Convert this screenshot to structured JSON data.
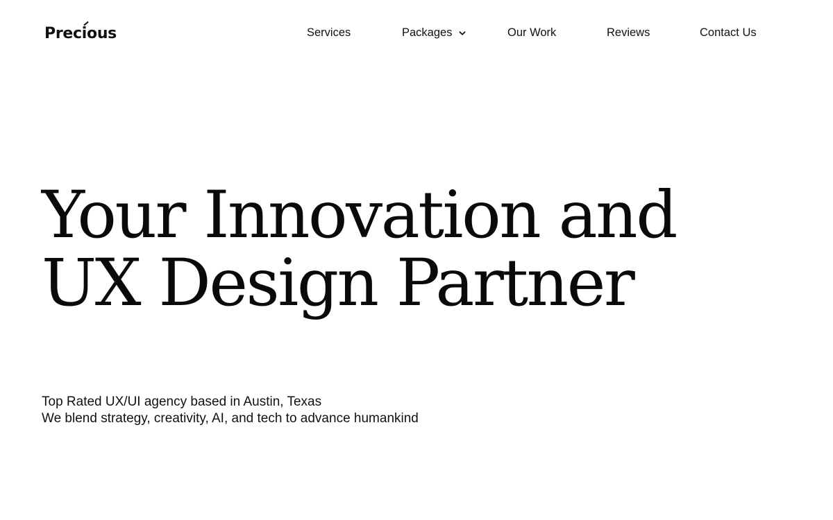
{
  "header": {
    "logo": {
      "prefix": "Prec",
      "i": "i",
      "suffix": "ous"
    },
    "nav": [
      {
        "label": "Services"
      },
      {
        "label": "Packages",
        "has_dropdown": true,
        "icon": "chevron-down-icon"
      },
      {
        "label": "Our Work"
      },
      {
        "label": "Reviews"
      },
      {
        "label": "Contact Us"
      }
    ]
  },
  "hero": {
    "title_lines": [
      "Your Innovation and",
      "UX Design Partner"
    ],
    "subtitle_lines": [
      "Top Rated UX/UI agency based in Austin, Texas",
      "We blend strategy, creativity, AI, and tech to advance humankind"
    ]
  },
  "colors": {
    "text": "#0a0a0a",
    "background": "#ffffff"
  }
}
